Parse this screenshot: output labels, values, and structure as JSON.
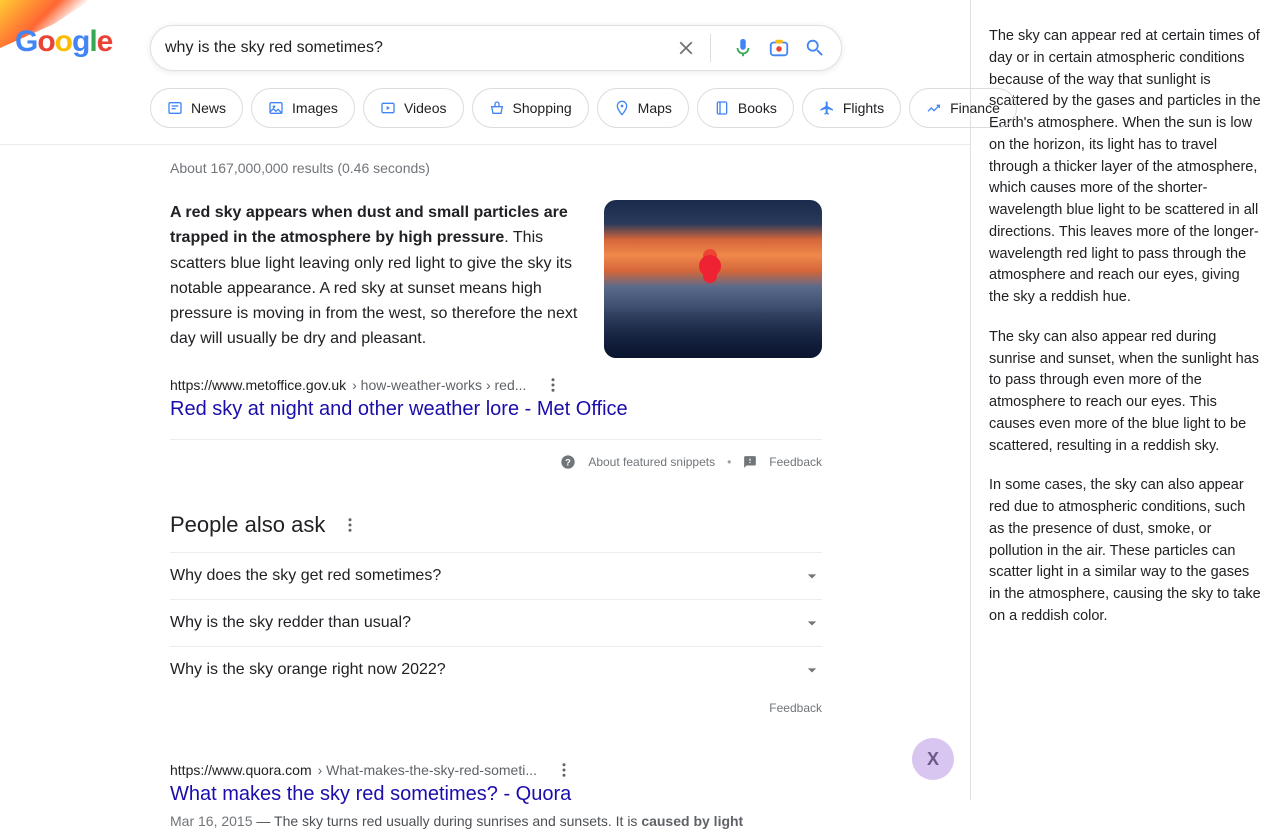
{
  "logo_text": "Google",
  "search": {
    "query": "why is the sky red sometimes?"
  },
  "chips": [
    {
      "label": "News",
      "icon": "news"
    },
    {
      "label": "Images",
      "icon": "images"
    },
    {
      "label": "Videos",
      "icon": "videos"
    },
    {
      "label": "Shopping",
      "icon": "shopping"
    },
    {
      "label": "Maps",
      "icon": "maps"
    },
    {
      "label": "Books",
      "icon": "books"
    },
    {
      "label": "Flights",
      "icon": "flights"
    },
    {
      "label": "Finance",
      "icon": "finance"
    }
  ],
  "stats": "About 167,000,000 results (0.46 seconds)",
  "featured": {
    "bold_text": "A red sky appears when dust and small particles are trapped in the atmosphere by high pressure",
    "rest_text": ". This scatters blue light leaving only red light to give the sky its notable appearance. A red sky at sunset means high pressure is moving in from the west, so therefore the next day will usually be dry and pleasant.",
    "cite_url": "https://www.metoffice.gov.uk",
    "cite_path": " › how-weather-works › red...",
    "title": "Red sky at night and other weather lore - Met Office",
    "about_label": "About featured snippets",
    "feedback_label": "Feedback"
  },
  "paa": {
    "heading": "People also ask",
    "items": [
      "Why does the sky get red sometimes?",
      "Why is the sky redder than usual?",
      "Why is the sky orange right now 2022?"
    ],
    "feedback_label": "Feedback"
  },
  "result2": {
    "cite_url": "https://www.quora.com",
    "cite_path": " › What-makes-the-sky-red-someti...",
    "title": "What makes the sky red sometimes? - Quora",
    "date": "Mar 16, 2015",
    "sep": " — ",
    "desc_pre": "The sky turns red usually during sunrises and sunsets. It is ",
    "desc_bold": "caused by light"
  },
  "fab_label": "X",
  "sidebar": {
    "p1": "The sky can appear red at certain times of day or in certain atmospheric conditions because of the way that sunlight is scattered by the gases and particles in the Earth's atmosphere. When the sun is low on the horizon, its light has to travel through a thicker layer of the atmosphere, which causes more of the shorter-wavelength blue light to be scattered in all directions. This leaves more of the longer-wavelength red light to pass through the atmosphere and reach our eyes, giving the sky a reddish hue.",
    "p2": "The sky can also appear red during sunrise and sunset, when the sunlight has to pass through even more of the atmosphere to reach our eyes. This causes even more of the blue light to be scattered, resulting in a reddish sky.",
    "p3": "In some cases, the sky can also appear red due to atmospheric conditions, such as the presence of dust, smoke, or pollution in the air. These particles can scatter light in a similar way to the gases in the atmosphere, causing the sky to take on a reddish color."
  }
}
